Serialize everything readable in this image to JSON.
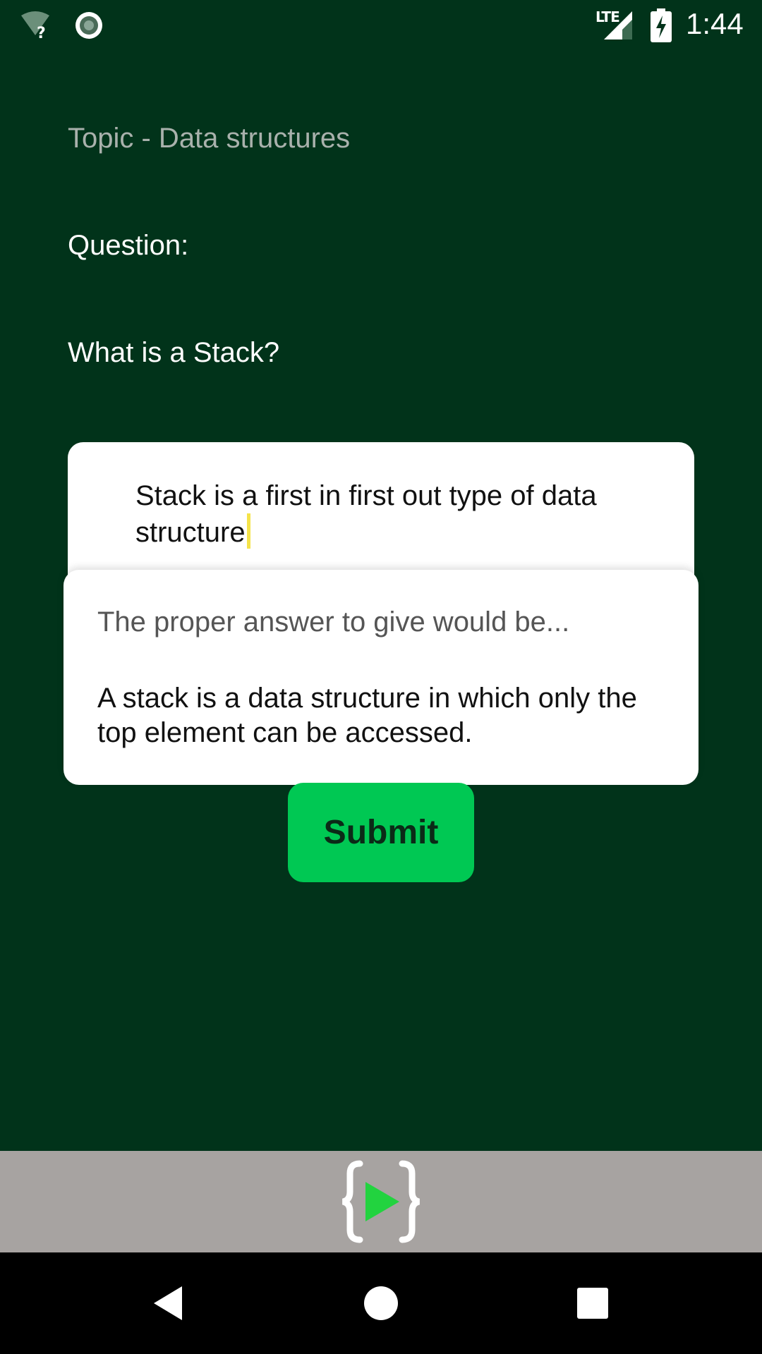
{
  "status_bar": {
    "time": "1:44",
    "network_label": "LTE",
    "icons": [
      "wifi-unknown-icon",
      "sync-icon",
      "signal-icon",
      "battery-charging-icon"
    ]
  },
  "topic": "Topic - Data structures",
  "question_label": "Question:",
  "question_text": "What is a Stack?",
  "answer_input": {
    "value": "Stack is a first in first out type of data structure"
  },
  "popup": {
    "title": "The proper answer to give would be...",
    "body": "A stack is a data structure in which only the top element can be accessed."
  },
  "submit_label": "Submit",
  "bottom_bar": {
    "logo_icon": "code-play-logo-icon"
  },
  "colors": {
    "background": "#01331a",
    "accent": "#00c853",
    "bottom_bar": "#a7a3a1"
  }
}
